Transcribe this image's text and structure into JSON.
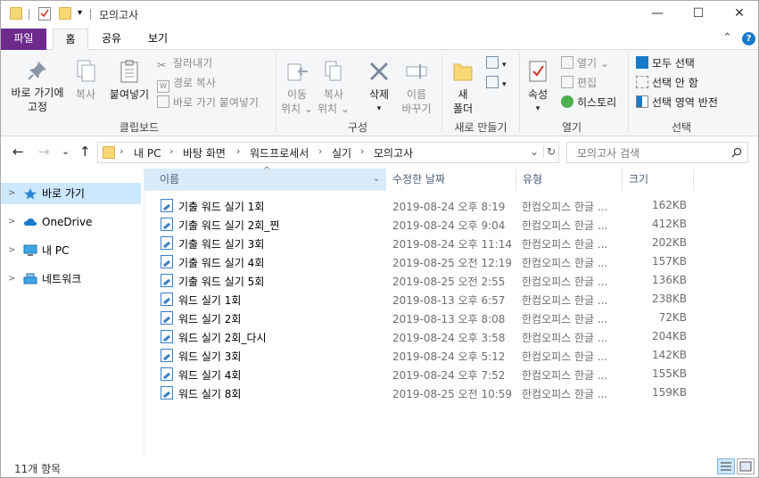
{
  "window": {
    "title": "모의고사",
    "quick_access_toolbar": [
      "folder-icon",
      "properties-check-icon",
      "new-folder-icon",
      "dropdown-icon"
    ],
    "controls": {
      "minimize": "—",
      "maximize": "☐",
      "close": "✕"
    }
  },
  "ribbon": {
    "tabs": {
      "file": "파일",
      "home": "홈",
      "share": "공유",
      "view": "보기"
    },
    "collapse_glyph": "⌃",
    "help_glyph": "?",
    "clipboard": {
      "group_label": "클립보드",
      "pin_line1": "바로 가기에",
      "pin_line2": "고정",
      "copy": "복사",
      "paste": "붙여넣기",
      "cut": "잘라내기",
      "copy_path": "경로 복사",
      "paste_shortcut": "바로 가기 붙여넣기"
    },
    "organize": {
      "group_label": "구성",
      "move_to_l1": "이동",
      "move_to_l2": "위치 ⌄",
      "copy_to_l1": "복사",
      "copy_to_l2": "위치 ⌄",
      "delete": "삭제",
      "delete_arrow": "▾",
      "rename_l1": "이름",
      "rename_l2": "바꾸기"
    },
    "new": {
      "group_label": "새로 만들기",
      "new_folder_l1": "새",
      "new_folder_l2": "폴더"
    },
    "open": {
      "group_label": "열기",
      "properties": "속성",
      "properties_arrow": "▾",
      "open": "열기 ⌄",
      "edit": "편집",
      "history": "히스토리"
    },
    "select": {
      "group_label": "선택",
      "select_all": "모두 선택",
      "select_none": "선택 안 함",
      "invert": "선택 영역 반전"
    }
  },
  "address": {
    "back": "←",
    "forward": "→",
    "recent": "⌄",
    "up": "↑",
    "breadcrumb": [
      "내 PC",
      "바탕 화면",
      "워드프로세서",
      "실기",
      "모의고사"
    ],
    "crumb_sep": "›",
    "dropdown": "⌄",
    "refresh": "↻",
    "search_placeholder": "모의고사 검색"
  },
  "nav_pane": {
    "items": [
      {
        "label": "바로 가기",
        "icon": "star-icon",
        "selected": true
      },
      {
        "label": "OneDrive",
        "icon": "cloud-icon",
        "selected": false
      },
      {
        "label": "내 PC",
        "icon": "computer-icon",
        "selected": false
      },
      {
        "label": "네트워크",
        "icon": "network-icon",
        "selected": false
      }
    ],
    "expand_glyph": ">"
  },
  "file_list": {
    "columns": {
      "name": "이름",
      "date": "수정한 날짜",
      "type": "유형",
      "size": "크기"
    },
    "sort_indicator": "^",
    "files": [
      {
        "name": "기출 워드 실기 1회",
        "date": "2019-08-24 오후 8:19",
        "type": "한컴오피스 한글 ...",
        "size": "162KB"
      },
      {
        "name": "기출 워드 실기 2회_찐",
        "date": "2019-08-24 오후 9:04",
        "type": "한컴오피스 한글 ...",
        "size": "412KB"
      },
      {
        "name": "기출 워드 실기 3회",
        "date": "2019-08-24 오후 11:14",
        "type": "한컴오피스 한글 ...",
        "size": "202KB"
      },
      {
        "name": "기출 워드 실기 4회",
        "date": "2019-08-25 오전 12:19",
        "type": "한컴오피스 한글 ...",
        "size": "157KB"
      },
      {
        "name": "기출 워드 실기 5회",
        "date": "2019-08-25 오전 2:55",
        "type": "한컴오피스 한글 ...",
        "size": "136KB"
      },
      {
        "name": "워드 실기 1회",
        "date": "2019-08-13 오후 6:57",
        "type": "한컴오피스 한글 ...",
        "size": "238KB"
      },
      {
        "name": "워드 실기 2회",
        "date": "2019-08-13 오후 8:08",
        "type": "한컴오피스 한글 ...",
        "size": "72KB"
      },
      {
        "name": "워드 실기 2회_다시",
        "date": "2019-08-24 오후 3:58",
        "type": "한컴오피스 한글 ...",
        "size": "204KB"
      },
      {
        "name": "워드 실기 3회",
        "date": "2019-08-24 오후 5:12",
        "type": "한컴오피스 한글 ...",
        "size": "142KB"
      },
      {
        "name": "워드 실기 4회",
        "date": "2019-08-24 오후 7:52",
        "type": "한컴오피스 한글 ...",
        "size": "155KB"
      },
      {
        "name": "워드 실기 8회",
        "date": "2019-08-25 오전 10:59",
        "type": "한컴오피스 한글 ...",
        "size": "159KB"
      }
    ]
  },
  "status": {
    "item_count": "11개 항목"
  },
  "colors": {
    "file_tab": "#6e2b8e",
    "selection": "#cce8ff",
    "header_text": "#4c607a"
  }
}
